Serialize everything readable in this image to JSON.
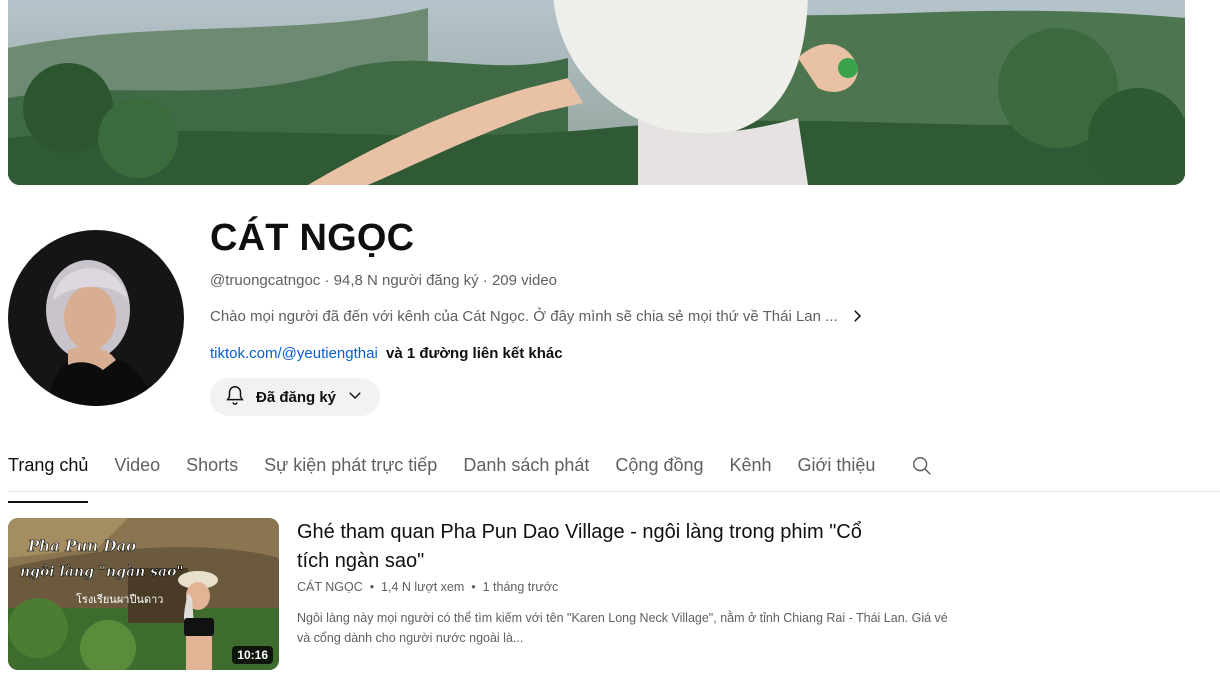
{
  "channel": {
    "name": "CÁT NGỌC",
    "handle": "@truongcatngoc",
    "subscribers": "94,8 N người đăng ký",
    "video_count": "209 video",
    "description": "Chào mọi người đã đến với kênh của Cát Ngọc. Ở đây mình sẽ chia sẻ mọi thứ về Thái Lan ...",
    "link_text": "tiktok.com/@yeutiengthai",
    "more_links": "và 1 đường liên kết khác",
    "subscribe_label": "Đã đăng ký"
  },
  "tabs": [
    {
      "label": "Trang chủ",
      "active": true
    },
    {
      "label": "Video"
    },
    {
      "label": "Shorts"
    },
    {
      "label": "Sự kiện phát trực tiếp"
    },
    {
      "label": "Danh sách phát"
    },
    {
      "label": "Cộng đồng"
    },
    {
      "label": "Kênh"
    },
    {
      "label": "Giới thiệu"
    }
  ],
  "video": {
    "title": "Ghé tham quan Pha Pun Dao Village - ngôi làng trong phim \"Cổ tích ngàn sao\"",
    "channel": "CÁT NGỌC",
    "views": "1,4 N lượt xem",
    "age": "1 tháng trước",
    "description": "Ngôi làng này mọi người có thể tìm kiếm với tên \"Karen Long Neck Village\", nằm ở tỉnh Chiang Rai - Thái Lan. Giá vé và cổng dành cho người nước ngoài là...",
    "duration": "10:16",
    "thumb_text_1": "Pha Pun Dao",
    "thumb_text_2": "ngôi làng \"ngàn sao\"",
    "thumb_text_3": "โรงเรียนผาปืนดาว"
  },
  "icons": {
    "bell": "bell-icon",
    "chevron_down": "chevron-down-icon",
    "chevron_right": "chevron-right-icon",
    "search": "search-icon"
  },
  "colors": {
    "link": "#065fd4",
    "text_secondary": "#606060",
    "button_bg": "#f2f2f2"
  }
}
